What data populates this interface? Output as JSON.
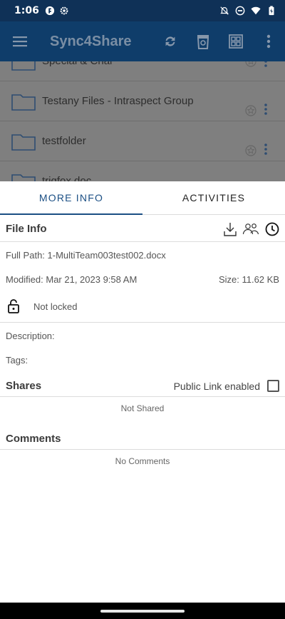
{
  "status": {
    "time": "1:06",
    "left_icons": [
      "app-badge-icon",
      "gear-icon"
    ],
    "right_icons": [
      "notifications-off-icon",
      "do-not-disturb-icon",
      "wifi-icon",
      "battery-icon"
    ]
  },
  "app_bar": {
    "title": "Sync4Share",
    "actions": [
      "sync-icon",
      "recycle-bin-icon",
      "grid-view-icon",
      "more-vert-icon"
    ]
  },
  "background_list": {
    "items": [
      "Special & Char",
      "Testany Files - Intraspect Group",
      "testfolder",
      "trigfox.doc"
    ]
  },
  "tabs": {
    "more_info": "MORE INFO",
    "activities": "ACTIVITIES",
    "active": "more_info"
  },
  "file_info": {
    "title": "File Info",
    "full_path": "Full Path: 1-MultiTeam003test002.docx",
    "modified": "Modified: Mar 21, 2023 9:58 AM",
    "size": "Size: 11.62 KB",
    "lock_status": "Not locked",
    "description_label": "Description:",
    "tags_label": "Tags:"
  },
  "shares": {
    "title": "Shares",
    "public_link_label": "Public Link enabled",
    "public_link_enabled": false,
    "empty_text": "Not Shared"
  },
  "comments": {
    "title": "Comments",
    "empty_text": "No Comments"
  },
  "colors": {
    "status_bar": "#0f3157",
    "app_bar": "#0f3d6a",
    "accent": "#1b4f84",
    "scrim": "#7f7f7f"
  }
}
